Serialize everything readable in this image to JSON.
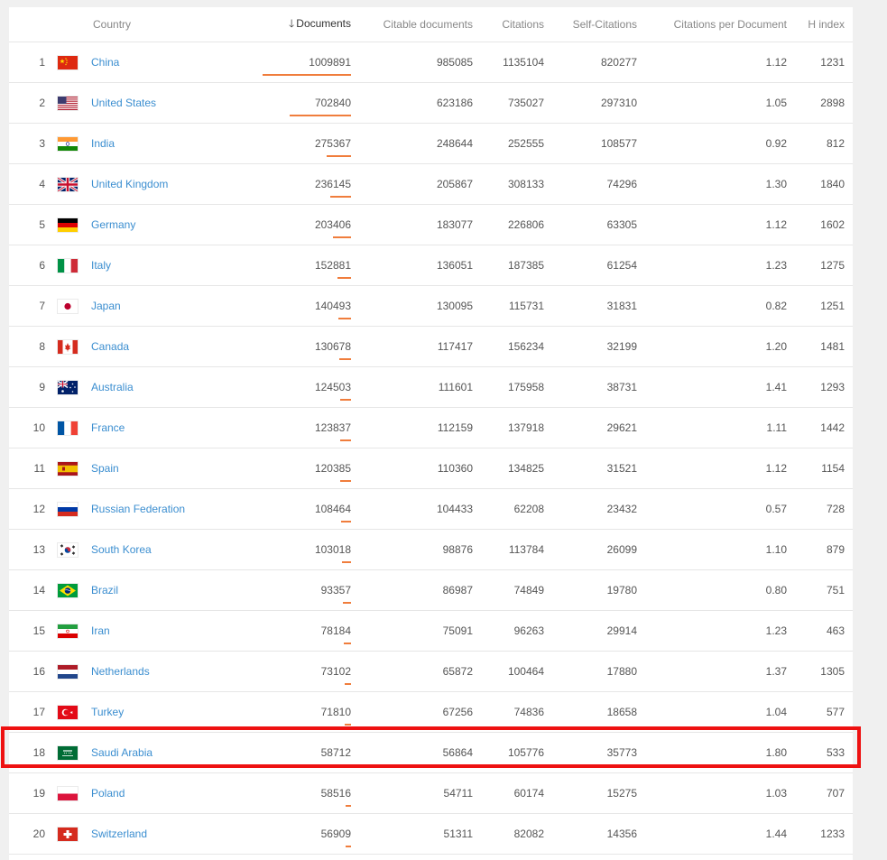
{
  "columns": {
    "country": "Country",
    "documents": "Documents",
    "citable": "Citable documents",
    "citations": "Citations",
    "self": "Self-Citations",
    "cpd": "Citations per Document",
    "hindex": "H index"
  },
  "sort": {
    "column": "documents",
    "direction": "descending",
    "arrow_icon": "arrow-down-icon"
  },
  "bar_color": "#f07d3c",
  "link_color": "#3b8ed0",
  "highlight_color": "#ee1111",
  "highlighted_rank": 18,
  "rows": [
    {
      "rank": "1",
      "flag": "cn",
      "country": "China",
      "documents": "1009891",
      "citable": "985085",
      "citations": "1135104",
      "self": "820277",
      "cpd": "1.12",
      "hindex": "1231"
    },
    {
      "rank": "2",
      "flag": "us",
      "country": "United States",
      "documents": "702840",
      "citable": "623186",
      "citations": "735027",
      "self": "297310",
      "cpd": "1.05",
      "hindex": "2898"
    },
    {
      "rank": "3",
      "flag": "in",
      "country": "India",
      "documents": "275367",
      "citable": "248644",
      "citations": "252555",
      "self": "108577",
      "cpd": "0.92",
      "hindex": "812"
    },
    {
      "rank": "4",
      "flag": "gb",
      "country": "United Kingdom",
      "documents": "236145",
      "citable": "205867",
      "citations": "308133",
      "self": "74296",
      "cpd": "1.30",
      "hindex": "1840"
    },
    {
      "rank": "5",
      "flag": "de",
      "country": "Germany",
      "documents": "203406",
      "citable": "183077",
      "citations": "226806",
      "self": "63305",
      "cpd": "1.12",
      "hindex": "1602"
    },
    {
      "rank": "6",
      "flag": "it",
      "country": "Italy",
      "documents": "152881",
      "citable": "136051",
      "citations": "187385",
      "self": "61254",
      "cpd": "1.23",
      "hindex": "1275"
    },
    {
      "rank": "7",
      "flag": "jp",
      "country": "Japan",
      "documents": "140493",
      "citable": "130095",
      "citations": "115731",
      "self": "31831",
      "cpd": "0.82",
      "hindex": "1251"
    },
    {
      "rank": "8",
      "flag": "ca",
      "country": "Canada",
      "documents": "130678",
      "citable": "117417",
      "citations": "156234",
      "self": "32199",
      "cpd": "1.20",
      "hindex": "1481"
    },
    {
      "rank": "9",
      "flag": "au",
      "country": "Australia",
      "documents": "124503",
      "citable": "111601",
      "citations": "175958",
      "self": "38731",
      "cpd": "1.41",
      "hindex": "1293"
    },
    {
      "rank": "10",
      "flag": "fr",
      "country": "France",
      "documents": "123837",
      "citable": "112159",
      "citations": "137918",
      "self": "29621",
      "cpd": "1.11",
      "hindex": "1442"
    },
    {
      "rank": "11",
      "flag": "es",
      "country": "Spain",
      "documents": "120385",
      "citable": "110360",
      "citations": "134825",
      "self": "31521",
      "cpd": "1.12",
      "hindex": "1154"
    },
    {
      "rank": "12",
      "flag": "ru",
      "country": "Russian Federation",
      "documents": "108464",
      "citable": "104433",
      "citations": "62208",
      "self": "23432",
      "cpd": "0.57",
      "hindex": "728"
    },
    {
      "rank": "13",
      "flag": "kr",
      "country": "South Korea",
      "documents": "103018",
      "citable": "98876",
      "citations": "113784",
      "self": "26099",
      "cpd": "1.10",
      "hindex": "879"
    },
    {
      "rank": "14",
      "flag": "br",
      "country": "Brazil",
      "documents": "93357",
      "citable": "86987",
      "citations": "74849",
      "self": "19780",
      "cpd": "0.80",
      "hindex": "751"
    },
    {
      "rank": "15",
      "flag": "ir",
      "country": "Iran",
      "documents": "78184",
      "citable": "75091",
      "citations": "96263",
      "self": "29914",
      "cpd": "1.23",
      "hindex": "463"
    },
    {
      "rank": "16",
      "flag": "nl",
      "country": "Netherlands",
      "documents": "73102",
      "citable": "65872",
      "citations": "100464",
      "self": "17880",
      "cpd": "1.37",
      "hindex": "1305"
    },
    {
      "rank": "17",
      "flag": "tr",
      "country": "Turkey",
      "documents": "71810",
      "citable": "67256",
      "citations": "74836",
      "self": "18658",
      "cpd": "1.04",
      "hindex": "577"
    },
    {
      "rank": "18",
      "flag": "sa",
      "country": "Saudi Arabia",
      "documents": "58712",
      "citable": "56864",
      "citations": "105776",
      "self": "35773",
      "cpd": "1.80",
      "hindex": "533"
    },
    {
      "rank": "19",
      "flag": "pl",
      "country": "Poland",
      "documents": "58516",
      "citable": "54711",
      "citations": "60174",
      "self": "15275",
      "cpd": "1.03",
      "hindex": "707"
    },
    {
      "rank": "20",
      "flag": "ch",
      "country": "Switzerland",
      "documents": "56909",
      "citable": "51311",
      "citations": "82082",
      "self": "14356",
      "cpd": "1.44",
      "hindex": "1233"
    }
  ]
}
